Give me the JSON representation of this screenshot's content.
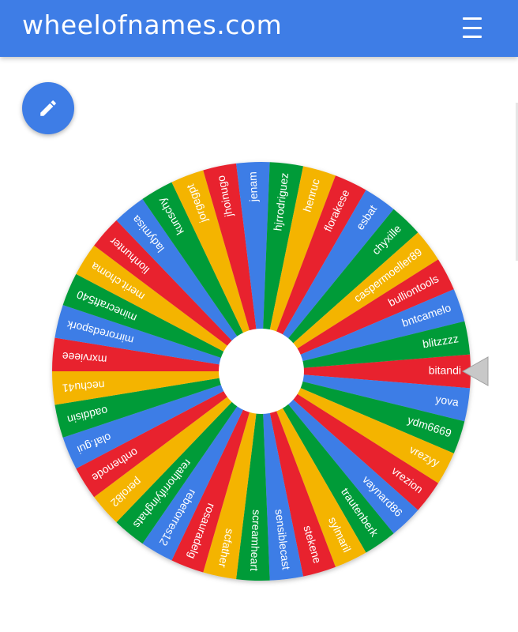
{
  "header": {
    "title": "wheelofnames.com",
    "menu_icon": "hamburger-menu-icon",
    "color": "#3e7de6"
  },
  "edit_button": {
    "icon": "pencil-icon"
  },
  "wheel": {
    "colors": [
      "#e8232f",
      "#3e7de6",
      "#009b39",
      "#f4b400"
    ],
    "pointer_color": "#c8c8c8",
    "names": [
      "bitandi",
      "yova",
      "ydm6669",
      "vrezyy",
      "vrezion",
      "vaynard86",
      "trautenberk",
      "sylmaril",
      "stekene",
      "sensiblecast",
      "screamheart",
      "scfather",
      "rosauradelg",
      "rebetorres12",
      "realhorrifyinghats",
      "perol82",
      "onthenode",
      "olaf.gui",
      "oaddisin",
      "nechu41",
      "mxrvieee",
      "mirroredspork",
      "minecraft540",
      "merit.choma",
      "lionhunter",
      "ladymisa",
      "kunschy",
      "jorgegpt",
      "jhoinugo",
      "jenam",
      "hjrrodriguez",
      "henruc",
      "florakese",
      "esbat",
      "chyxille",
      "caspermoeller89",
      "bulliontools",
      "bntcamelo",
      "blitzzzz"
    ]
  }
}
